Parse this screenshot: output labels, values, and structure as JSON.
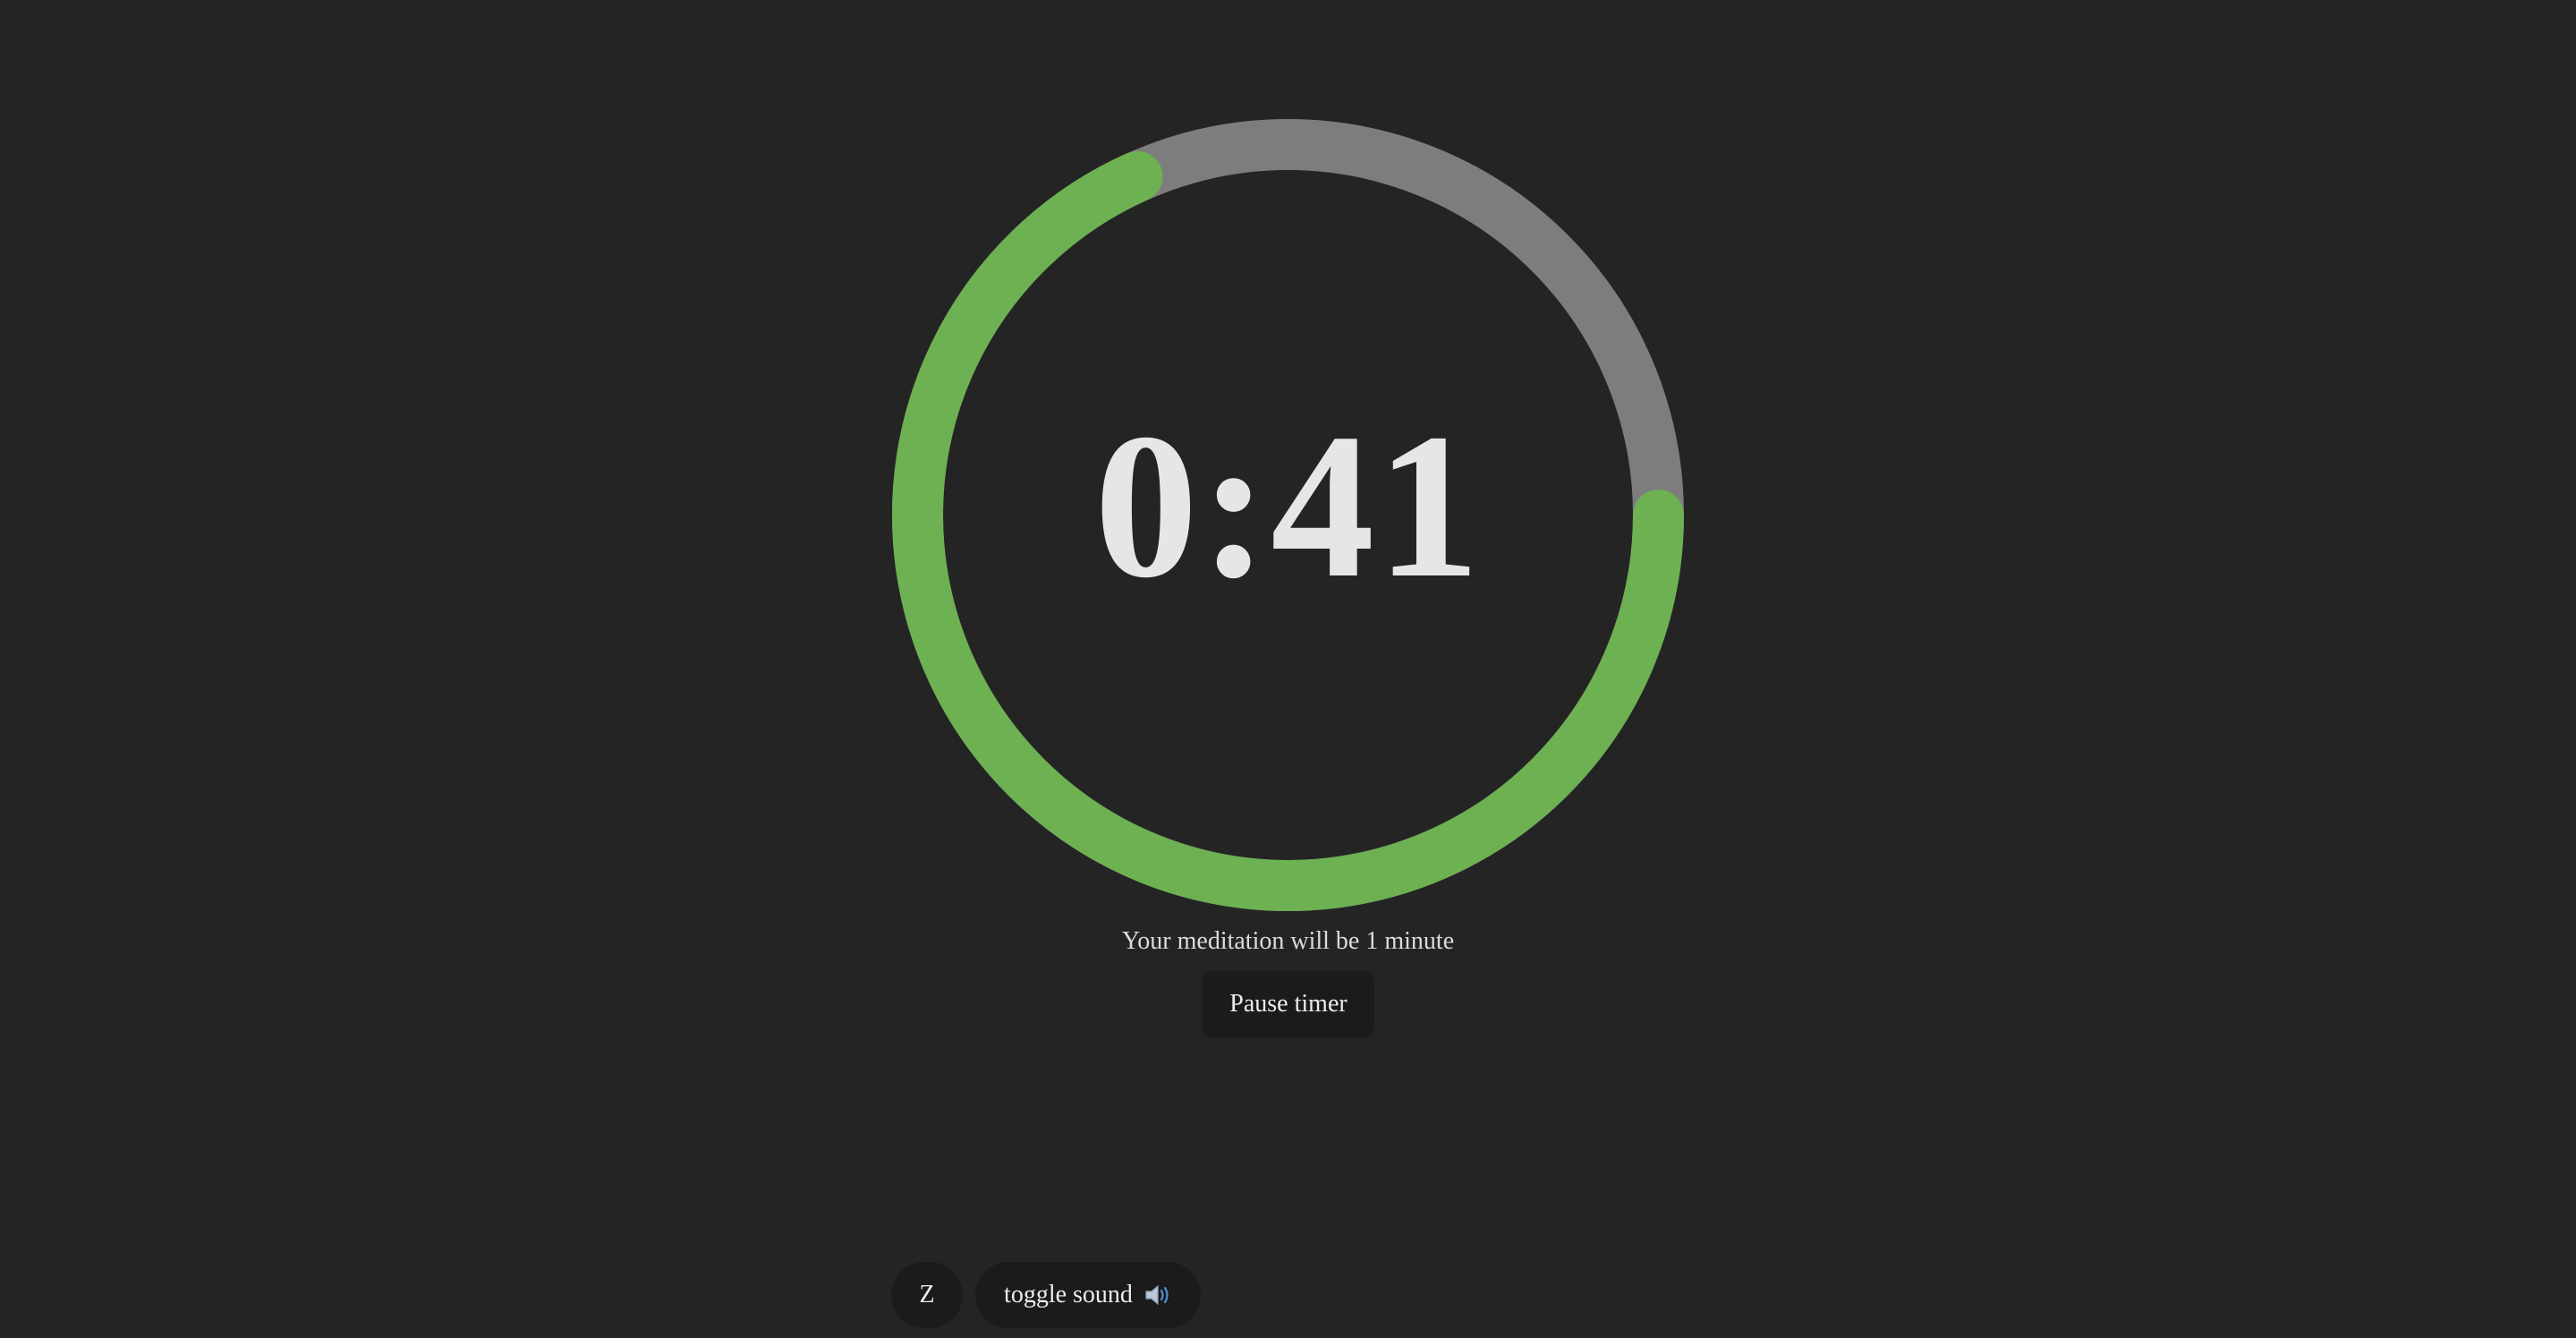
{
  "timer": {
    "display": "0:41",
    "remaining_fraction": 0.6833,
    "track_color": "#7d7d7d",
    "progress_color": "#6db152"
  },
  "caption": "Your meditation will be 1 minute",
  "controls": {
    "pause_label": "Pause timer",
    "z_label": "Z",
    "sound_label": "toggle sound",
    "sound_icon": "speaker-icon"
  }
}
